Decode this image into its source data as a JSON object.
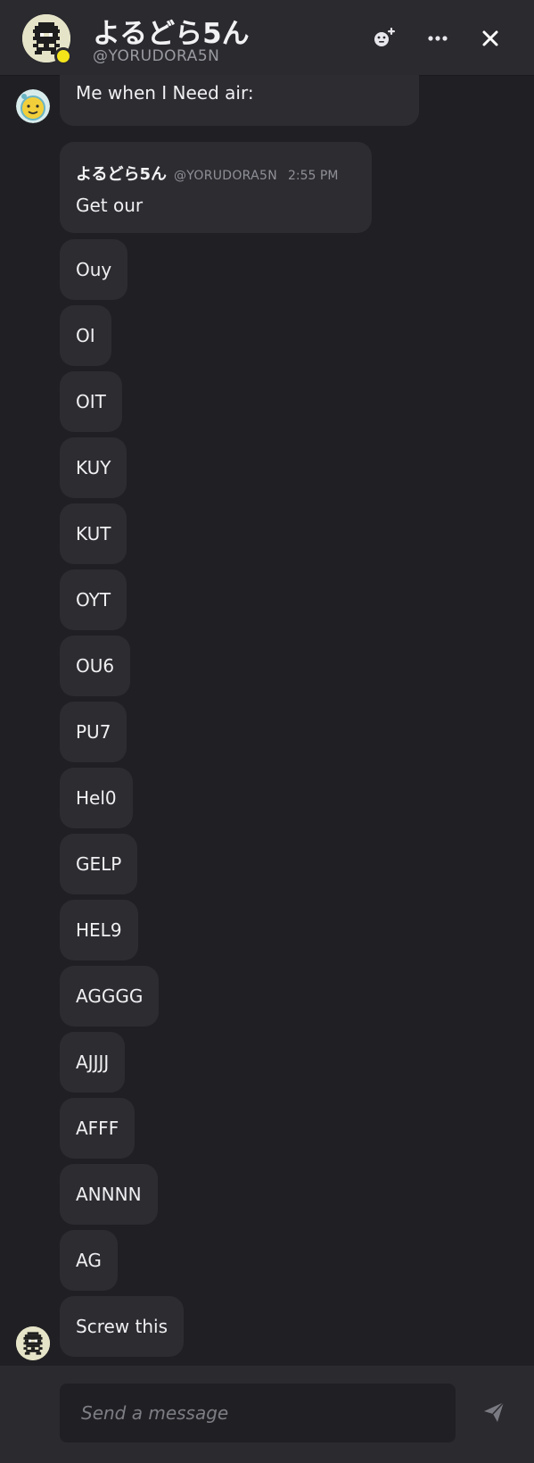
{
  "header": {
    "display_name": "よるどら5ん",
    "handle": "@YORUDORA5N",
    "status": "online"
  },
  "messages": {
    "first_partial": {
      "text": "Me when I Need air:"
    },
    "quoted": {
      "author_name": "よるどら5ん",
      "author_handle": "@YORUDORA5N",
      "time": "2:55 PM",
      "text": "Get our"
    },
    "items": [
      {
        "text": "Ouy"
      },
      {
        "text": "OI"
      },
      {
        "text": "OIT"
      },
      {
        "text": "KUY"
      },
      {
        "text": "KUT"
      },
      {
        "text": "OYT"
      },
      {
        "text": "OU6"
      },
      {
        "text": "PU7"
      },
      {
        "text": "Hel0"
      },
      {
        "text": "GELP"
      },
      {
        "text": "HEL9"
      },
      {
        "text": "AGGGG"
      },
      {
        "text": "AJJJJ"
      },
      {
        "text": "AFFF"
      },
      {
        "text": "ANNNN"
      },
      {
        "text": "AG"
      },
      {
        "text": "Screw this"
      }
    ]
  },
  "composer": {
    "placeholder": "Send a message",
    "value": ""
  },
  "icons": {
    "add_friend": "add-friend-icon",
    "more": "more-options-icon",
    "close": "close-icon",
    "send": "send-icon"
  },
  "colors": {
    "background": "#202024",
    "header": "#2a2a2f",
    "bubble": "#2c2c31",
    "status_online": "#f4e51b"
  }
}
